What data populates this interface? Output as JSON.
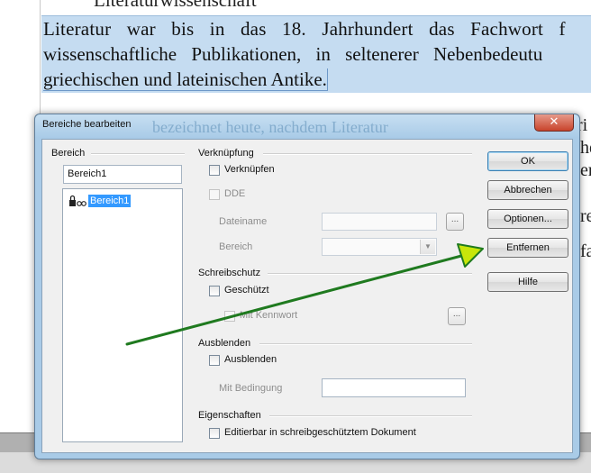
{
  "document": {
    "heading_fragment": "Literaturwissenschaft",
    "line1": "Literatur war bis in das 18. Jahrhundert das Fachwort f",
    "line2": "wissenschaftliche Publikationen, in seltenerer Nebenbedeutu",
    "line3": "griechischen und lateinischen Antike.",
    "behind_dialog_fragment": "bezeichnet heute, nachdem Literatur",
    "right_fragments": [
      "ri",
      "he",
      "er",
      "re",
      "fa"
    ]
  },
  "dialog": {
    "title": "Bereiche bearbeiten",
    "close_glyph": "✕",
    "section_group": {
      "label": "Bereich",
      "name_value": "Bereich1",
      "tree_item": "Bereich1"
    },
    "link_group": {
      "label": "Verknüpfung",
      "link_checkbox": "Verknüpfen",
      "dde_checkbox": "DDE",
      "filename_label": "Dateiname",
      "section_label": "Bereich",
      "browse_glyph": "..."
    },
    "protect_group": {
      "label": "Schreibschutz",
      "protected_checkbox": "Geschützt",
      "password_checkbox": "Mit Kennwort",
      "password_glyph": "..."
    },
    "hide_group": {
      "label": "Ausblenden",
      "hide_checkbox": "Ausblenden",
      "condition_label": "Mit Bedingung"
    },
    "properties_group": {
      "label": "Eigenschaften",
      "editable_checkbox": "Editierbar in schreibgeschütztem Dokument"
    },
    "buttons": {
      "ok": "OK",
      "cancel": "Abbrechen",
      "options": "Optionen...",
      "remove": "Entfernen",
      "help": "Hilfe"
    }
  },
  "colors": {
    "selection": "#c5dcf1",
    "arrow": "#1f7a1f",
    "arrowhead_fill": "#c8e60a",
    "dialog_frame": "#a9cbe7"
  }
}
